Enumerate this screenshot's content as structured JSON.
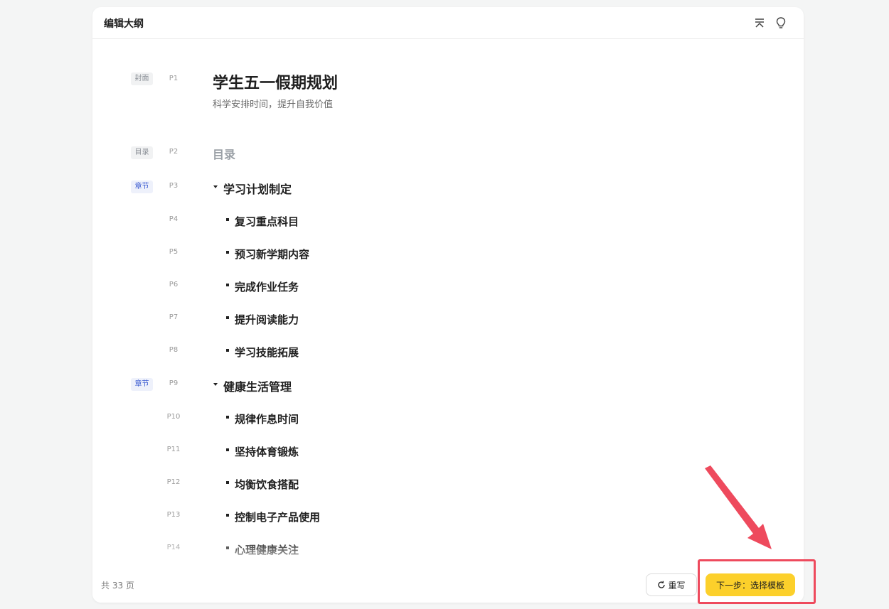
{
  "header": {
    "title": "编辑大纲"
  },
  "outline": {
    "cover": {
      "tag": "封面",
      "page": "P1",
      "title": "学生五一假期规划",
      "subtitle": "科学安排时间，提升自我价值"
    },
    "toc": {
      "tag": "目录",
      "page": "P2",
      "title": "目录"
    },
    "chapters": [
      {
        "tag": "章节",
        "page": "P3",
        "title": "学习计划制定",
        "items": [
          {
            "page": "P4",
            "title": "复习重点科目"
          },
          {
            "page": "P5",
            "title": "预习新学期内容"
          },
          {
            "page": "P6",
            "title": "完成作业任务"
          },
          {
            "page": "P7",
            "title": "提升阅读能力"
          },
          {
            "page": "P8",
            "title": "学习技能拓展"
          }
        ]
      },
      {
        "tag": "章节",
        "page": "P9",
        "title": "健康生活管理",
        "items": [
          {
            "page": "P10",
            "title": "规律作息时间"
          },
          {
            "page": "P11",
            "title": "坚持体育锻炼"
          },
          {
            "page": "P12",
            "title": "均衡饮食搭配"
          },
          {
            "page": "P13",
            "title": "控制电子产品使用"
          },
          {
            "page": "P14",
            "title": "心理健康关注"
          }
        ]
      }
    ]
  },
  "footer": {
    "page_count": "共 33 页",
    "rewrite_label": "重写",
    "next_label": "下一步：选择模板"
  },
  "icons": {
    "collapse": "collapse-all-icon",
    "tips": "lightbulb-icon",
    "refresh": "refresh-icon"
  },
  "colors": {
    "accent": "#fcd02b",
    "chapter_tag": "#3b5bd1",
    "annotation": "#ee4a5d"
  }
}
